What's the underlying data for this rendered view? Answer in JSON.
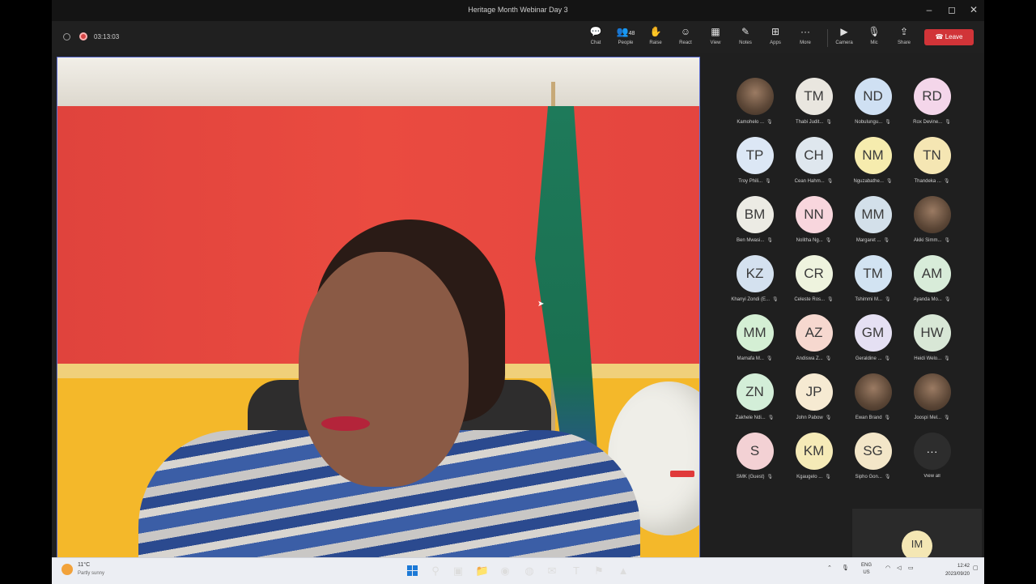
{
  "window": {
    "title": "Heritage Month Webinar Day 3",
    "controls": [
      "–",
      "◻",
      "✕"
    ]
  },
  "meeting_bar": {
    "timer": "03:13:03",
    "people_count": "48",
    "items": [
      {
        "id": "chat",
        "label": "Chat",
        "icon": "chat-icon",
        "glyph": "💬"
      },
      {
        "id": "people",
        "label": "People",
        "icon": "people-icon",
        "glyph": "👥"
      },
      {
        "id": "raise",
        "label": "Raise",
        "icon": "raise-hand-icon",
        "glyph": "✋"
      },
      {
        "id": "react",
        "label": "React",
        "icon": "react-icon",
        "glyph": "☺"
      },
      {
        "id": "view",
        "label": "View",
        "icon": "view-icon",
        "glyph": "▦"
      },
      {
        "id": "notes",
        "label": "Notes",
        "icon": "notes-icon",
        "glyph": "✎"
      },
      {
        "id": "apps",
        "label": "Apps",
        "icon": "apps-icon",
        "glyph": "⊞"
      },
      {
        "id": "more",
        "label": "More",
        "icon": "more-icon",
        "glyph": "···"
      },
      {
        "id": "camera",
        "label": "Camera",
        "icon": "camera-off-icon",
        "glyph": "▶"
      },
      {
        "id": "mic",
        "label": "Mic",
        "icon": "mic-off-icon",
        "glyph": "🎙"
      },
      {
        "id": "share",
        "label": "Share",
        "icon": "share-icon",
        "glyph": "⇪"
      }
    ],
    "leave_label": "Leave",
    "leave_color": "#d13438"
  },
  "participants": [
    {
      "initials": "",
      "name": "Kamohelo ...",
      "photo": true,
      "color": ""
    },
    {
      "initials": "TM",
      "name": "Thabi Judit...",
      "photo": false,
      "color": "#e9e6df"
    },
    {
      "initials": "ND",
      "name": "Nobulungu...",
      "photo": false,
      "color": "#cfe0f3"
    },
    {
      "initials": "RD",
      "name": "Rox Devine...",
      "photo": false,
      "color": "#f4d6ea"
    },
    {
      "initials": "TP",
      "name": "Troy Phili...",
      "photo": false,
      "color": "#dce7f5"
    },
    {
      "initials": "CH",
      "name": "Cean Hahm...",
      "photo": false,
      "color": "#dfe7ee"
    },
    {
      "initials": "NM",
      "name": "Nguzabathe...",
      "photo": false,
      "color": "#f6ecae"
    },
    {
      "initials": "TN",
      "name": "Thandeka ...",
      "photo": false,
      "color": "#f5e6b3"
    },
    {
      "initials": "BM",
      "name": "Ben Mwasi...",
      "photo": false,
      "color": "#ecebe4"
    },
    {
      "initials": "NN",
      "name": "Nolitha Ng...",
      "photo": false,
      "color": "#f8d6dd"
    },
    {
      "initials": "MM",
      "name": "Margaret ...",
      "photo": false,
      "color": "#d3e0ea"
    },
    {
      "initials": "",
      "name": "Akiki Simm...",
      "photo": true,
      "color": ""
    },
    {
      "initials": "KZ",
      "name": "Khanyi Zondi (E...",
      "photo": false,
      "color": "#d4e1ef"
    },
    {
      "initials": "CR",
      "name": "Celeste Ros...",
      "photo": false,
      "color": "#eef3de"
    },
    {
      "initials": "TM",
      "name": "Tshimmi M...",
      "photo": false,
      "color": "#d2e3f2"
    },
    {
      "initials": "AM",
      "name": "Ayanda Mo...",
      "photo": false,
      "color": "#d8ecd9"
    },
    {
      "initials": "MM",
      "name": "Mamafa M...",
      "photo": false,
      "color": "#d4efd4"
    },
    {
      "initials": "AZ",
      "name": "Andiswa Z...",
      "photo": false,
      "color": "#f6d8cf"
    },
    {
      "initials": "GM",
      "name": "Geraldine ...",
      "photo": false,
      "color": "#e5e0f3"
    },
    {
      "initials": "HW",
      "name": "Heidi Welo...",
      "photo": false,
      "color": "#d8e7d6"
    },
    {
      "initials": "ZN",
      "name": "Zakhele Ndi...",
      "photo": false,
      "color": "#d3eed8"
    },
    {
      "initials": "JP",
      "name": "John Pabow",
      "photo": false,
      "color": "#f6ead2"
    },
    {
      "initials": "",
      "name": "Ewan Brand",
      "photo": true,
      "color": ""
    },
    {
      "initials": "",
      "name": "Joospi Mel...",
      "photo": true,
      "color": ""
    },
    {
      "initials": "S",
      "name": "SMK (Guest)",
      "photo": false,
      "color": "#f3d1d4"
    },
    {
      "initials": "KM",
      "name": "Kgaugelo ...",
      "photo": false,
      "color": "#f5eab7"
    },
    {
      "initials": "SG",
      "name": "Sipho Gon...",
      "photo": false,
      "color": "#f3e6c8"
    },
    {
      "initials": "···",
      "name": "View all",
      "photo": false,
      "color": "#2d2d2d",
      "more": true
    }
  ],
  "self_view": {
    "initials": "IM"
  },
  "taskbar": {
    "weather_temp": "11°C",
    "weather_desc": "Partly sunny",
    "language": "ENG",
    "language_region": "US",
    "time": "12:42",
    "date": "2023/09/20",
    "apps": [
      {
        "name": "start-icon",
        "glyph": "⊞"
      },
      {
        "name": "search-icon",
        "glyph": "⚲"
      },
      {
        "name": "task-view-icon",
        "glyph": "▣"
      },
      {
        "name": "file-explorer-icon",
        "glyph": "📁"
      },
      {
        "name": "edge-icon",
        "glyph": "◉"
      },
      {
        "name": "chrome-icon",
        "glyph": "◍"
      },
      {
        "name": "outlook-icon",
        "glyph": "✉"
      },
      {
        "name": "teams-icon",
        "glyph": "T"
      },
      {
        "name": "pin-app-icon",
        "glyph": "⚑"
      },
      {
        "name": "vlc-icon",
        "glyph": "▲"
      }
    ]
  }
}
